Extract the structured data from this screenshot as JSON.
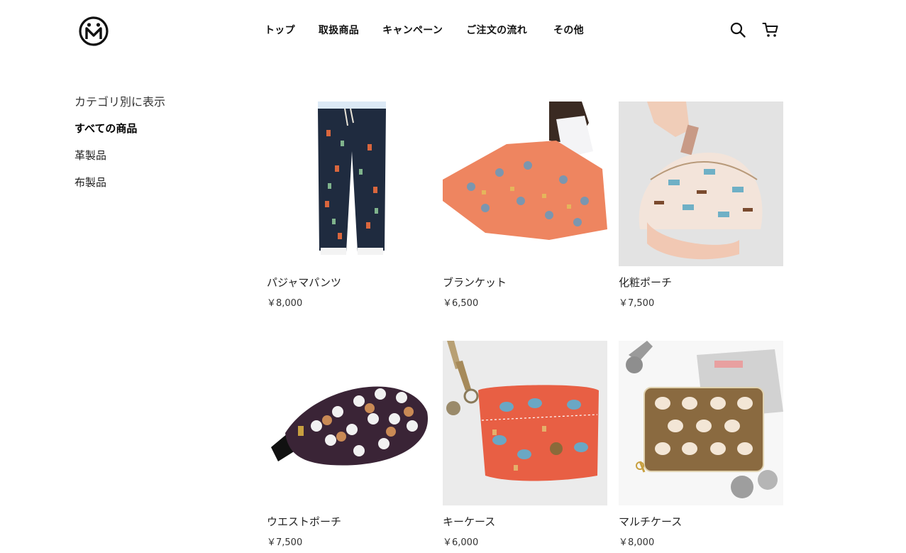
{
  "brand": {
    "logo_icon": "smiley-m-logo-icon"
  },
  "nav": [
    {
      "label": "トップ"
    },
    {
      "label": "取扱商品"
    },
    {
      "label": "キャンペーン"
    },
    {
      "label": "ご注文の流れ"
    },
    {
      "label": "その他"
    }
  ],
  "header_icons": {
    "search": "search-icon",
    "cart": "cart-icon"
  },
  "sidebar": {
    "title": "カテゴリ別に表示",
    "items": [
      {
        "label": "すべての商品",
        "active": true
      },
      {
        "label": "革製品",
        "active": false
      },
      {
        "label": "布製品",
        "active": false
      }
    ]
  },
  "products": [
    {
      "name": "パジャマパンツ",
      "price": "￥8,000"
    },
    {
      "name": "ブランケット",
      "price": "￥6,500"
    },
    {
      "name": "化粧ポーチ",
      "price": "￥7,500"
    },
    {
      "name": "ウエストポーチ",
      "price": "￥7,500"
    },
    {
      "name": "キーケース",
      "price": "￥6,000"
    },
    {
      "name": "マルチケース",
      "price": "￥8,000"
    }
  ]
}
